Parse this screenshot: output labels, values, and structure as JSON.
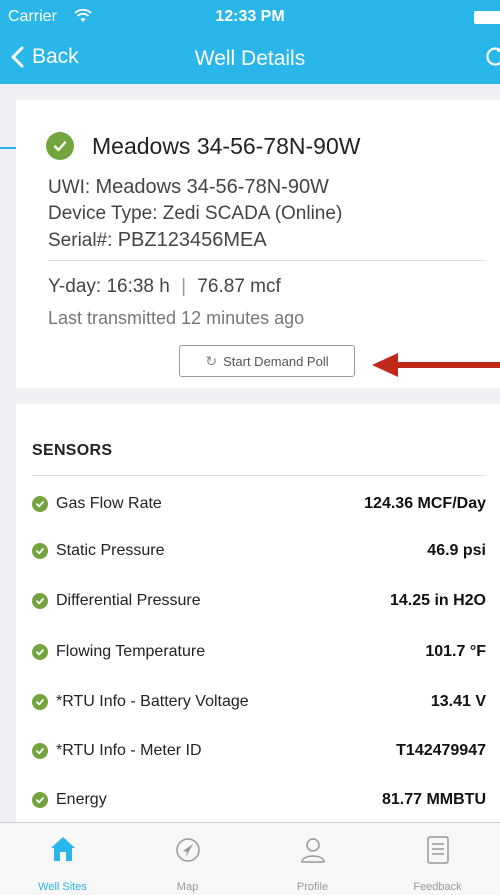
{
  "status_bar": {
    "carrier": "Carrier",
    "time": "12:33 PM"
  },
  "nav": {
    "back_label": "Back",
    "title": "Well Details"
  },
  "well": {
    "name": "Meadows 34-56-78N-90W",
    "uwi_label": "UWI:",
    "uwi_value": "Meadows 34-56-78N-90W",
    "device_type": "Device Type: Zedi SCADA (Online)",
    "serial_label": "Serial#:",
    "serial_value": "PBZ123456MEA",
    "yday_label": "Y-day:",
    "yday_hours": "16:38 h",
    "yday_separator": "|",
    "yday_volume": "76.87 mcf",
    "last_transmitted": "Last transmitted 12 minutes ago",
    "poll_button": "Start Demand Poll"
  },
  "sensors": {
    "title": "SENSORS",
    "items": [
      {
        "name": "Gas Flow Rate",
        "value": "124.36 MCF/Day"
      },
      {
        "name": "Static Pressure",
        "value": "46.9 psi"
      },
      {
        "name": "Differential Pressure",
        "value": "14.25 in H2O"
      },
      {
        "name": "Flowing Temperature",
        "value": "101.7 °F"
      },
      {
        "name": "*RTU Info - Battery Voltage",
        "value": "13.41 V"
      },
      {
        "name": "*RTU Info - Meter ID",
        "value": "T142479947"
      },
      {
        "name": "Energy",
        "value": "81.77 MMBTU"
      }
    ]
  },
  "tabs": [
    {
      "label": "Well Sites",
      "icon": "home-icon",
      "active": true
    },
    {
      "label": "Map",
      "icon": "navigation-icon",
      "active": false
    },
    {
      "label": "Profile",
      "icon": "person-icon",
      "active": false
    },
    {
      "label": "Feedback",
      "icon": "document-icon",
      "active": false
    }
  ],
  "colors": {
    "accent": "#29b6e8",
    "status_ok": "#74a53d",
    "annotation_arrow": "#c0281a"
  }
}
